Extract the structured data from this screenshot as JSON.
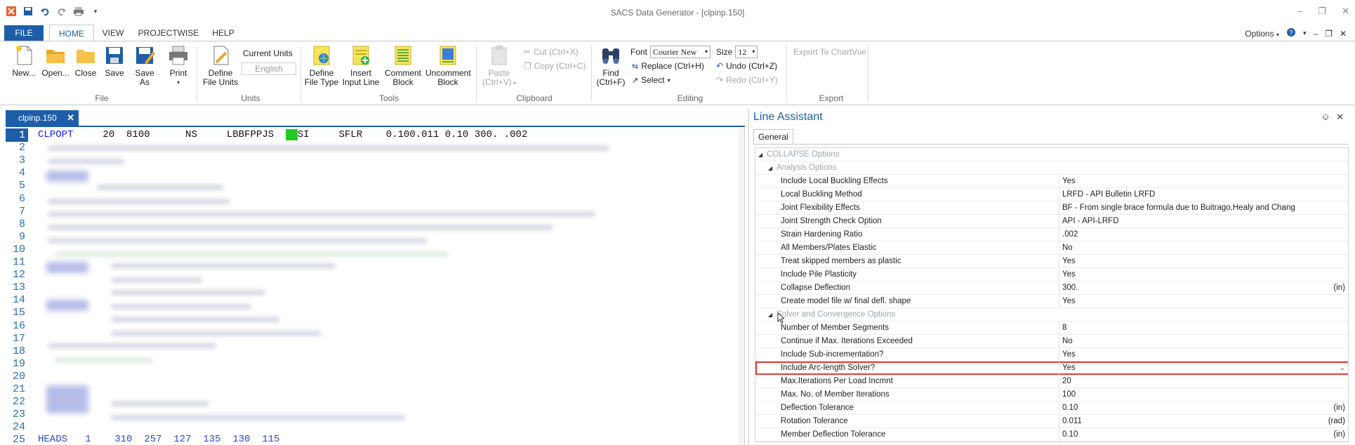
{
  "window": {
    "title": "SACS Data Generator - [clpinp.150]",
    "controls": {
      "minimize": "–",
      "restore": "❐",
      "close": "✕"
    }
  },
  "ribbon_tabs": {
    "file": "FILE",
    "home": "HOME",
    "view": "VIEW",
    "projectwise": "PROJECTWISE",
    "help": "HELP",
    "options": "Options"
  },
  "ribbon": {
    "file_group": {
      "label": "File",
      "new": "New...",
      "open": "Open...",
      "close": "Close",
      "save": "Save",
      "save_as": "Save As",
      "print": "Print"
    },
    "units_group": {
      "label": "Units",
      "define": "Define File Units",
      "current_units_label": "Current Units",
      "current_units_value": "English"
    },
    "tools_group": {
      "label": "Tools",
      "define_file_type": "Define File Type",
      "insert_input_line": "Insert Input Line",
      "comment_block": "Comment Block",
      "uncomment_block": "Uncomment Block"
    },
    "clipboard_group": {
      "label": "Clipboard",
      "paste": "Paste",
      "paste_shortcut": "(Ctrl+V)",
      "cut": "Cut (Ctrl+X)",
      "copy": "Copy (Ctrl+C)"
    },
    "editing_group": {
      "label": "Editing",
      "find": "Find",
      "find_shortcut": "(Ctrl+F)",
      "font_label": "Font",
      "font_value": "Courier New",
      "size_label": "Size",
      "size_value": "12",
      "replace": "Replace (Ctrl+H)",
      "select": "Select",
      "undo": "Undo (Ctrl+Z)",
      "redo": "Redo (Ctrl+Y)"
    },
    "export_group": {
      "label": "Export",
      "export_chartvue": "Export To ChartVue"
    }
  },
  "document": {
    "tab_name": "clpinp.150",
    "line_numbers": [
      "1",
      "2",
      "3",
      "4",
      "5",
      "6",
      "7",
      "8",
      "9",
      "10",
      "11",
      "12",
      "13",
      "14",
      "15",
      "16",
      "17",
      "18",
      "19",
      "20",
      "21",
      "22",
      "23",
      "24",
      "25"
    ],
    "line1": {
      "keyword": "CLPOPT",
      "rest_a": "     20  8100      NS     LBBFPPJS  ",
      "rest_b": "SI     SFLR    0.100.011 0.10 300. .002"
    },
    "last_line": "HEADS   1    310  257  127  135  130  115"
  },
  "panel": {
    "title": "Line Assistant",
    "pin": "⊕",
    "close": "✕",
    "tab": "General",
    "categories": {
      "collapse": "COLLAPSE Options",
      "analysis": "Analysis Options",
      "solver": "Solver and Convergence Options"
    },
    "analysis_rows": [
      {
        "label": "Include Local Buckling Effects",
        "value": "Yes",
        "unit": ""
      },
      {
        "label": "Local Buckling Method",
        "value": "LRFD - API Bulletin LRFD",
        "unit": ""
      },
      {
        "label": "Joint Flexibility Effects",
        "value": "BF - From single brace formula due to Buitrago,Healy and Chang",
        "unit": ""
      },
      {
        "label": "Joint Strength Check Option",
        "value": "API - API-LRFD",
        "unit": ""
      },
      {
        "label": "Strain Hardening Ratio",
        "value": ".002",
        "unit": ""
      },
      {
        "label": "All Members/Plates Elastic",
        "value": "No",
        "unit": ""
      },
      {
        "label": "Treat skipped members as plastic",
        "value": "Yes",
        "unit": ""
      },
      {
        "label": "Include Pile Plasticity",
        "value": "Yes",
        "unit": ""
      },
      {
        "label": "Collapse Deflection",
        "value": "300.",
        "unit": "(in)"
      },
      {
        "label": "Create model file w/ final defl. shape",
        "value": "Yes",
        "unit": ""
      }
    ],
    "solver_rows": [
      {
        "label": "Number of Member Segments",
        "value": "8",
        "unit": ""
      },
      {
        "label": "Continue if Max. Iterations Exceeded",
        "value": "No",
        "unit": ""
      },
      {
        "label": "Include Sub-incrementation?",
        "value": "Yes",
        "unit": ""
      },
      {
        "label": "Include Arc-length Solver?",
        "value": "Yes",
        "unit": ""
      },
      {
        "label": "Max.Iterations Per Load Incmnt",
        "value": "20",
        "unit": ""
      },
      {
        "label": "Max. No. of Member Iterations",
        "value": "100",
        "unit": ""
      },
      {
        "label": "Deflection Tolerance",
        "value": "0.10",
        "unit": "(in)"
      },
      {
        "label": "Rotation Tolerance",
        "value": "0.011",
        "unit": "(rad)"
      },
      {
        "label": "Member Deflection Tolerance",
        "value": "0.10",
        "unit": "(in)"
      }
    ]
  },
  "colors": {
    "accent": "#1e5ea8",
    "highlight": "#e03b3b",
    "green_cell": "#22cc22"
  }
}
